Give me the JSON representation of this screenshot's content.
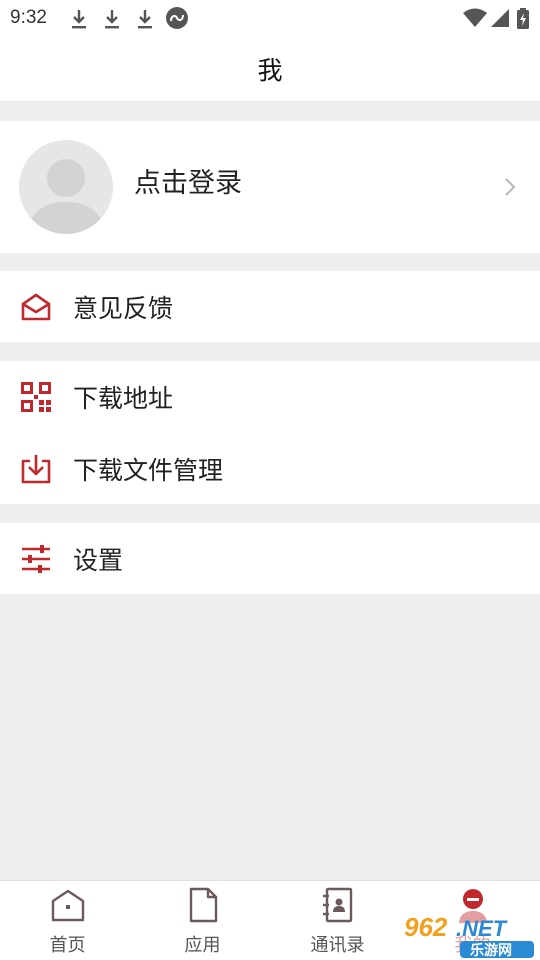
{
  "status_bar": {
    "time": "9:32"
  },
  "header": {
    "title": "我"
  },
  "profile": {
    "login_label": "点击登录"
  },
  "menu": {
    "feedback": "意见反馈",
    "download_address": "下载地址",
    "download_manager": "下载文件管理",
    "settings": "设置"
  },
  "tabbar": {
    "tabs": [
      {
        "label": "首页",
        "icon": "home-icon"
      },
      {
        "label": "应用",
        "icon": "document-icon"
      },
      {
        "label": "通讯录",
        "icon": "contacts-icon"
      },
      {
        "label": "我的",
        "icon": "profile-icon"
      }
    ],
    "active_tab": "我的"
  },
  "watermark": {
    "brand": "962.NET",
    "sub": "乐游网"
  },
  "colors": {
    "accent": "#c0282d",
    "background": "#efefef",
    "card": "#ffffff",
    "icon_gray": "#6b5a5a"
  }
}
